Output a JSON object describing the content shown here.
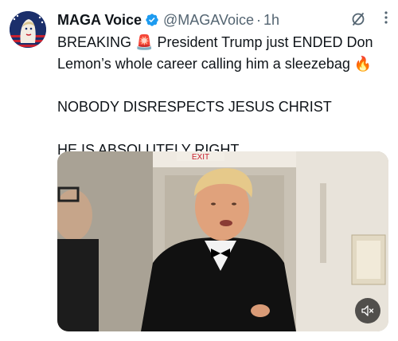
{
  "post": {
    "author_name": "MAGA Voice",
    "handle": "@MAGAVoice",
    "separator": "·",
    "time": "1h",
    "more_icon": "more-dots-icon",
    "grok_icon": "grok-icon",
    "text_line1": "BREAKING 🚨 President Trump just ENDED Don",
    "text_line2": "Lemon’s whole career calling him a sleezebag 🔥",
    "text_line3": "NOBODY DISRESPECTS JESUS CHRIST",
    "text_line4": "HE IS ABSOLUTELY RIGHT"
  },
  "media": {
    "sign_text": "EXIT",
    "mute_icon": "speaker-muted-icon"
  },
  "colors": {
    "verified": "#1d9bf0",
    "secondary_text": "#536471",
    "primary_text": "#0f1419"
  }
}
